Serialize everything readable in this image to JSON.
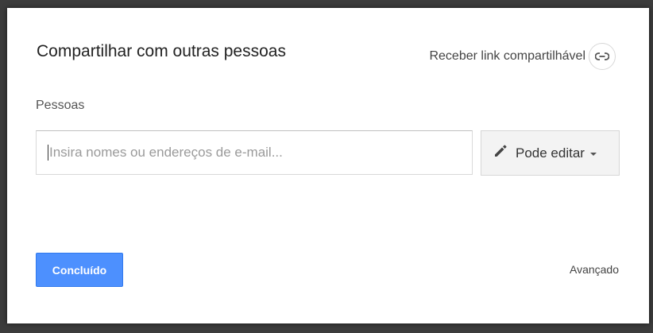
{
  "dialog": {
    "title": "Compartilhar com outras pessoas",
    "get_link_label": "Receber link compartilhável",
    "get_link_icon": "link-icon",
    "people_label": "Pessoas",
    "people_input": {
      "value": "",
      "placeholder": "Insira nomes ou endereços de e-mail..."
    },
    "permission": {
      "icon": "pencil-icon",
      "label": "Pode editar"
    },
    "done_label": "Concluído",
    "advanced_label": "Avançado"
  },
  "colors": {
    "primary_button": "#4d90fe",
    "primary_button_border": "#3079ed",
    "backdrop": "#3c3c3c"
  }
}
